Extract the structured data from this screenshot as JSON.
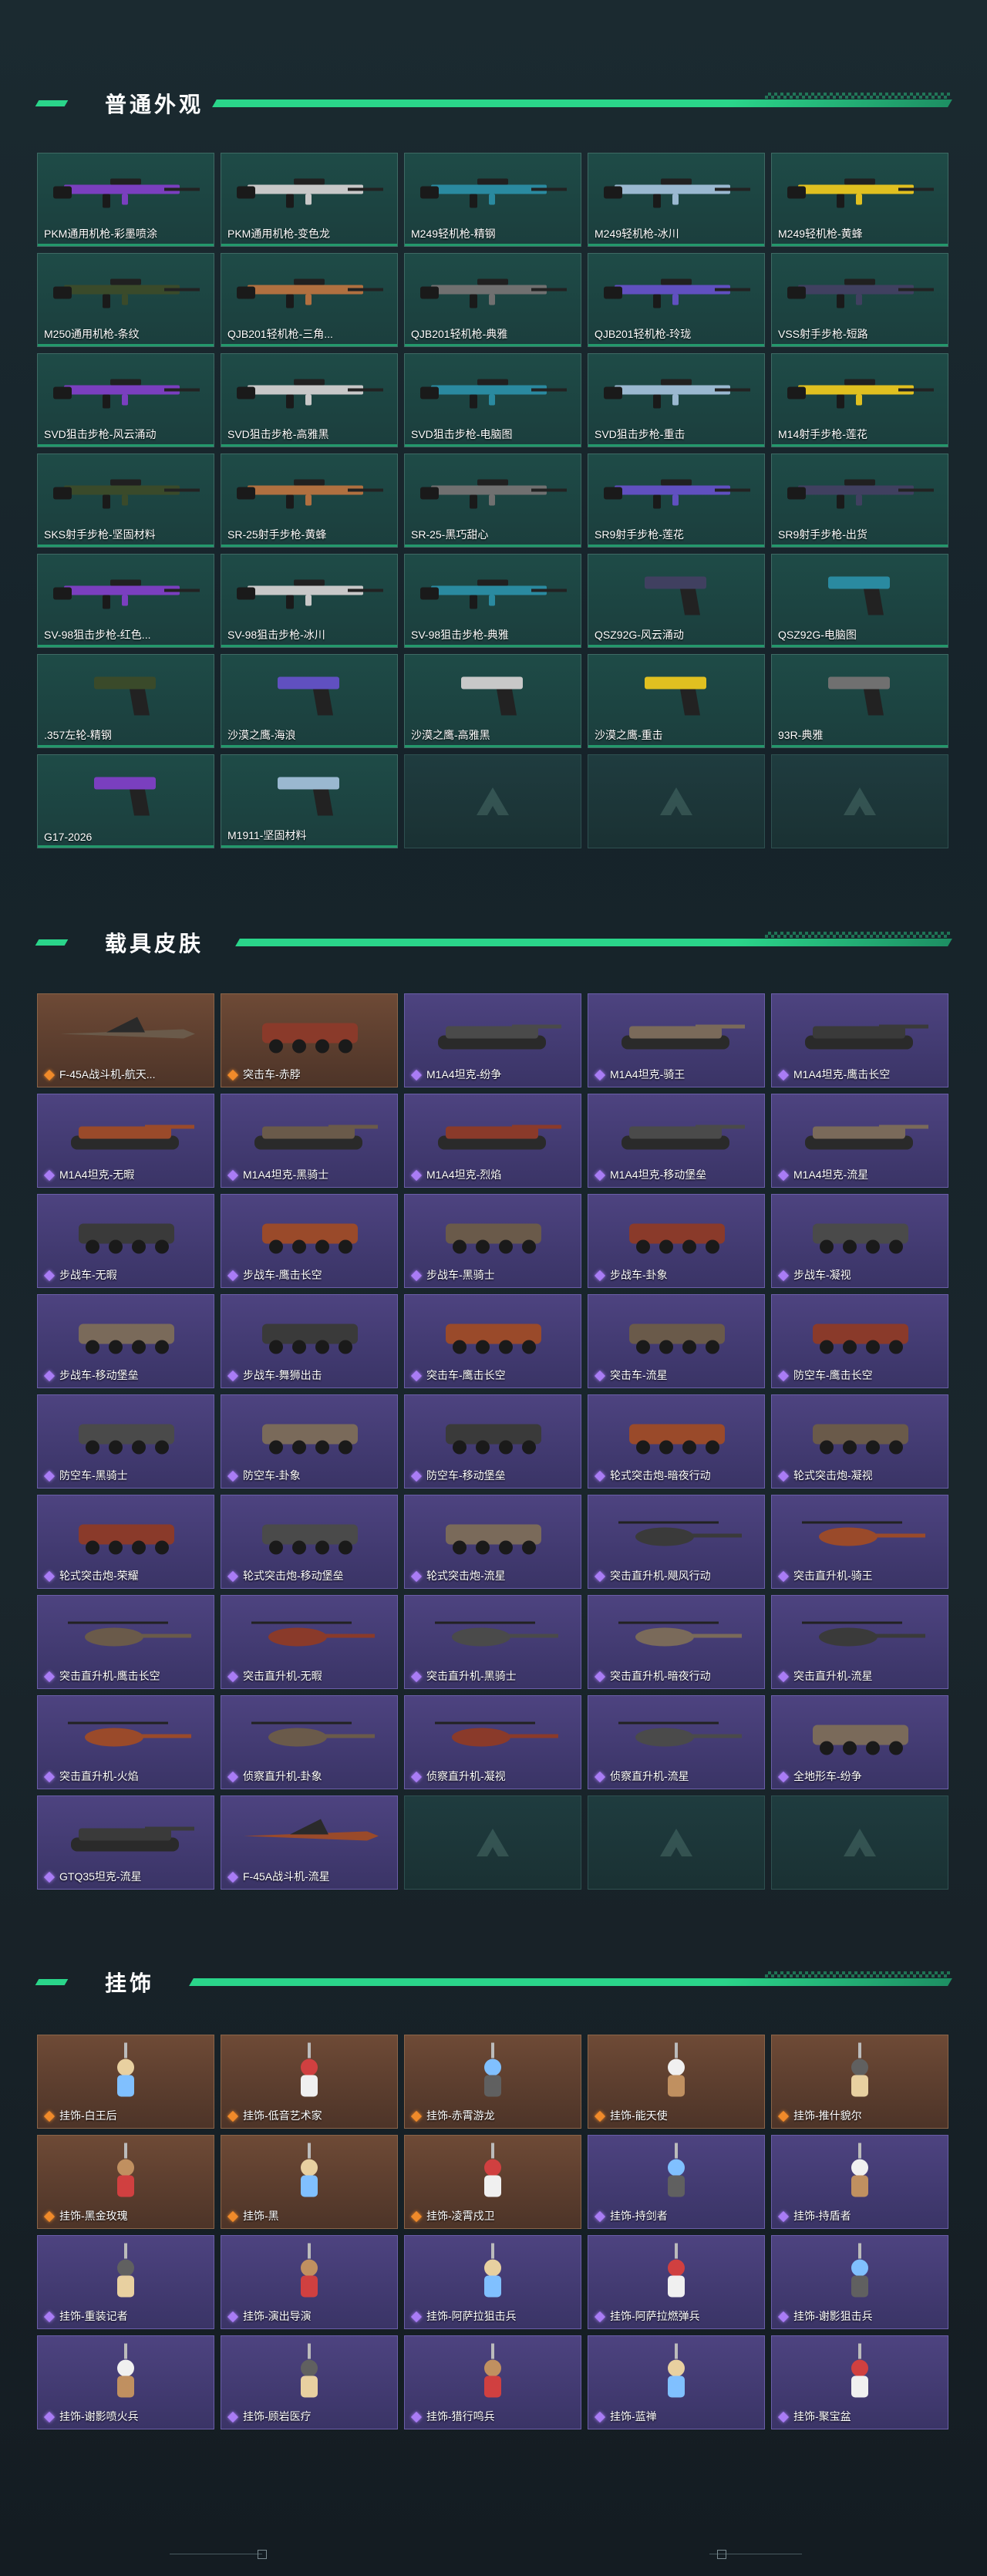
{
  "sections": [
    {
      "title": "普通外观"
    },
    {
      "title": "载具皮肤"
    },
    {
      "title": "挂饰"
    }
  ],
  "weapons": [
    "PKM通用机枪-彩墨喷涂",
    "PKM通用机枪-变色龙",
    "M249轻机枪-精钢",
    "M249轻机枪-冰川",
    "M249轻机枪-黄蜂",
    "M250通用机枪-条纹",
    "QJB201轻机枪-三角...",
    "QJB201轻机枪-典雅",
    "QJB201轻机枪-玲珑",
    "VSS射手步枪-短路",
    "SVD狙击步枪-风云涌动",
    "SVD狙击步枪-高雅黑",
    "SVD狙击步枪-电脑图",
    "SVD狙击步枪-重击",
    "M14射手步枪-莲花",
    "SKS射手步枪-坚固材料",
    "SR-25射手步枪-黄蜂",
    "SR-25-黑巧甜心",
    "SR9射手步枪-莲花",
    "SR9射手步枪-出货",
    "SV-98狙击步枪-红色...",
    "SV-98狙击步枪-冰川",
    "SV-98狙击步枪-典雅",
    "QSZ92G-风云涌动",
    "QSZ92G-电脑图",
    ".357左轮-精钢",
    "沙漠之鹰-海浪",
    "沙漠之鹰-高雅黑",
    "沙漠之鹰-重击",
    "93R-典雅",
    "G17-2026",
    "M1911-坚固材料"
  ],
  "vehicles": [
    {
      "label": "F-45A战斗机-航天...",
      "rarity": "orange"
    },
    {
      "label": "突击车-赤脖",
      "rarity": "orange"
    },
    {
      "label": "M1A4坦克-纷争",
      "rarity": "purple"
    },
    {
      "label": "M1A4坦克-骑王",
      "rarity": "purple"
    },
    {
      "label": "M1A4坦克-鹰击长空",
      "rarity": "purple"
    },
    {
      "label": "M1A4坦克-无暇",
      "rarity": "purple"
    },
    {
      "label": "M1A4坦克-黑骑士",
      "rarity": "purple"
    },
    {
      "label": "M1A4坦克-烈焰",
      "rarity": "purple"
    },
    {
      "label": "M1A4坦克-移动堡垒",
      "rarity": "purple"
    },
    {
      "label": "M1A4坦克-流星",
      "rarity": "purple"
    },
    {
      "label": "步战车-无暇",
      "rarity": "purple"
    },
    {
      "label": "步战车-鹰击长空",
      "rarity": "purple"
    },
    {
      "label": "步战车-黑骑士",
      "rarity": "purple"
    },
    {
      "label": "步战车-卦象",
      "rarity": "purple"
    },
    {
      "label": "步战车-凝视",
      "rarity": "purple"
    },
    {
      "label": "步战车-移动堡垒",
      "rarity": "purple"
    },
    {
      "label": "步战车-舞狮出击",
      "rarity": "purple"
    },
    {
      "label": "突击车-鹰击长空",
      "rarity": "purple"
    },
    {
      "label": "突击车-流星",
      "rarity": "purple"
    },
    {
      "label": "防空车-鹰击长空",
      "rarity": "purple"
    },
    {
      "label": "防空车-黑骑士",
      "rarity": "purple"
    },
    {
      "label": "防空车-卦象",
      "rarity": "purple"
    },
    {
      "label": "防空车-移动堡垒",
      "rarity": "purple"
    },
    {
      "label": "轮式突击炮-暗夜行动",
      "rarity": "purple"
    },
    {
      "label": "轮式突击炮-凝视",
      "rarity": "purple"
    },
    {
      "label": "轮式突击炮-荣耀",
      "rarity": "purple"
    },
    {
      "label": "轮式突击炮-移动堡垒",
      "rarity": "purple"
    },
    {
      "label": "轮式突击炮-流星",
      "rarity": "purple"
    },
    {
      "label": "突击直升机-飓风行动",
      "rarity": "purple"
    },
    {
      "label": "突击直升机-骑王",
      "rarity": "purple"
    },
    {
      "label": "突击直升机-鹰击长空",
      "rarity": "purple"
    },
    {
      "label": "突击直升机-无暇",
      "rarity": "purple"
    },
    {
      "label": "突击直升机-黑骑士",
      "rarity": "purple"
    },
    {
      "label": "突击直升机-暗夜行动",
      "rarity": "purple"
    },
    {
      "label": "突击直升机-流星",
      "rarity": "purple"
    },
    {
      "label": "突击直升机-火焰",
      "rarity": "purple"
    },
    {
      "label": "侦察直升机-卦象",
      "rarity": "purple"
    },
    {
      "label": "侦察直升机-凝视",
      "rarity": "purple"
    },
    {
      "label": "侦察直升机-流星",
      "rarity": "purple"
    },
    {
      "label": "全地形车-纷争",
      "rarity": "purple"
    },
    {
      "label": "GTQ35坦克-流星",
      "rarity": "purple"
    },
    {
      "label": "F-45A战斗机-流星",
      "rarity": "purple"
    }
  ],
  "pendants": [
    {
      "label": "挂饰-白王后",
      "rarity": "orange"
    },
    {
      "label": "挂饰-低音艺术家",
      "rarity": "orange"
    },
    {
      "label": "挂饰-赤霄游龙",
      "rarity": "orange"
    },
    {
      "label": "挂饰-能天使",
      "rarity": "orange"
    },
    {
      "label": "挂饰-推什貌尔",
      "rarity": "orange"
    },
    {
      "label": "挂饰-黑金玫瑰",
      "rarity": "orange"
    },
    {
      "label": "挂饰-黑",
      "rarity": "orange"
    },
    {
      "label": "挂饰-凌霄戍卫",
      "rarity": "orange"
    },
    {
      "label": "挂饰-持剑者",
      "rarity": "purple"
    },
    {
      "label": "挂饰-持盾者",
      "rarity": "purple"
    },
    {
      "label": "挂饰-重装记者",
      "rarity": "purple"
    },
    {
      "label": "挂饰-演出导演",
      "rarity": "purple"
    },
    {
      "label": "挂饰-阿萨拉狙击兵",
      "rarity": "purple"
    },
    {
      "label": "挂饰-阿萨拉燃弹兵",
      "rarity": "purple"
    },
    {
      "label": "挂饰-谢影狙击兵",
      "rarity": "purple"
    },
    {
      "label": "挂饰-谢影喷火兵",
      "rarity": "purple"
    },
    {
      "label": "挂饰-顾岩医疗",
      "rarity": "purple"
    },
    {
      "label": "挂饰-猎行鸣兵",
      "rarity": "purple"
    },
    {
      "label": "挂饰-蓝禅",
      "rarity": "purple"
    },
    {
      "label": "挂饰-聚宝盆",
      "rarity": "purple"
    }
  ]
}
